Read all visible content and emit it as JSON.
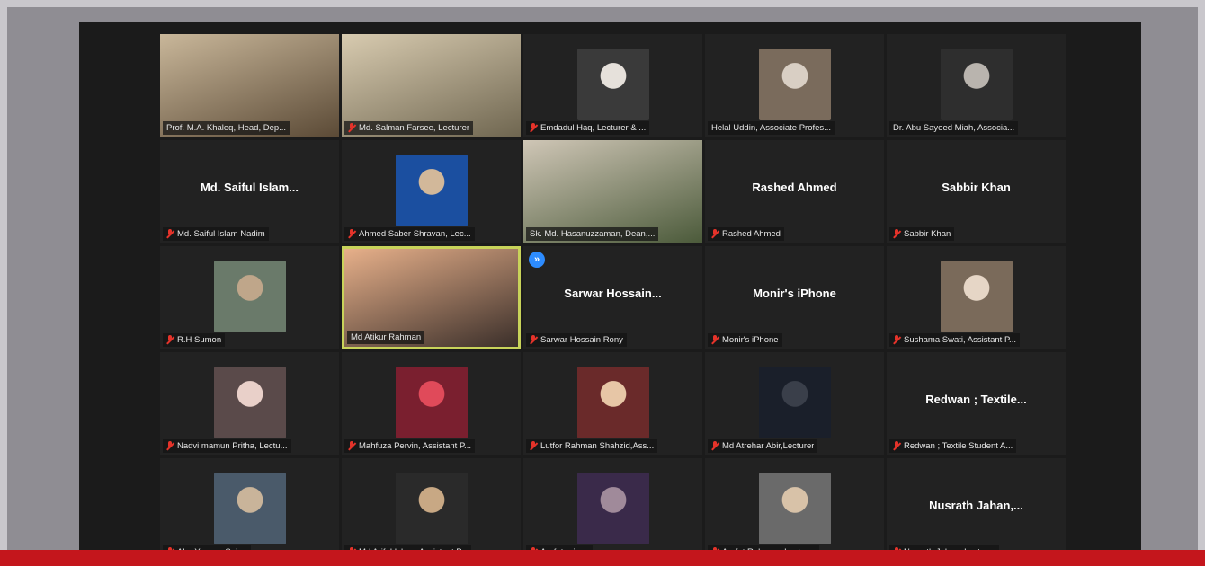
{
  "participants": [
    {
      "label": "Prof. M.A. Khaleq, Head, Dep...",
      "muted": false,
      "display": "video",
      "active": false
    },
    {
      "label": "Md. Salman Farsee, Lecturer",
      "muted": true,
      "display": "video",
      "active": false
    },
    {
      "label": "Emdadul Haq, Lecturer & ...",
      "muted": true,
      "display": "photo",
      "active": false
    },
    {
      "label": "Helal Uddin, Associate Profes...",
      "muted": false,
      "display": "photo",
      "active": false
    },
    {
      "label": "Dr. Abu Sayeed Miah, Associa...",
      "muted": false,
      "display": "photo",
      "active": false
    },
    {
      "label": "Md. Saiful Islam Nadim",
      "muted": true,
      "display": "name",
      "big_name": "Md. Saiful Islam...",
      "active": false
    },
    {
      "label": "Ahmed Saber Shravan, Lec...",
      "muted": true,
      "display": "photo",
      "active": false
    },
    {
      "label": "Sk. Md. Hasanuzzaman, Dean,...",
      "muted": false,
      "display": "video",
      "active": false
    },
    {
      "label": "Rashed Ahmed",
      "muted": true,
      "display": "name",
      "big_name": "Rashed Ahmed",
      "active": false
    },
    {
      "label": "Sabbir Khan",
      "muted": true,
      "display": "name",
      "big_name": "Sabbir Khan",
      "active": false
    },
    {
      "label": "R.H Sumon",
      "muted": true,
      "display": "photo",
      "active": false
    },
    {
      "label": "Md Atikur Rahman",
      "muted": false,
      "display": "video",
      "active": true
    },
    {
      "label": "Sarwar Hossain Rony",
      "muted": true,
      "display": "name",
      "big_name": "Sarwar Hossain...",
      "badge": "»",
      "active": false
    },
    {
      "label": "Monir's iPhone",
      "muted": true,
      "display": "name",
      "big_name": "Monir's iPhone",
      "active": false
    },
    {
      "label": "Sushama Swati, Assistant P...",
      "muted": true,
      "display": "photo",
      "active": false
    },
    {
      "label": "Nadvi mamun Pritha, Lectu...",
      "muted": true,
      "display": "photo",
      "active": false
    },
    {
      "label": "Mahfuza Pervin, Assistant P...",
      "muted": true,
      "display": "photo",
      "active": false
    },
    {
      "label": "Lutfor Rahman Shahzid,Ass...",
      "muted": true,
      "display": "photo",
      "active": false
    },
    {
      "label": "Md Atrehar Abir,Lecturer",
      "muted": true,
      "display": "photo",
      "active": false
    },
    {
      "label": "Redwan ; Textile Student A...",
      "muted": true,
      "display": "name",
      "big_name": "Redwan ; Textile...",
      "active": false
    },
    {
      "label": "Abu Younus Sujon",
      "muted": true,
      "display": "photo",
      "active": false
    },
    {
      "label": "Md Ariful Islam, Assistant P...",
      "muted": true,
      "display": "photo",
      "active": false
    },
    {
      "label": "Arafat prince",
      "muted": true,
      "display": "photo",
      "active": false
    },
    {
      "label": "Arafat Rahman, Lecturer",
      "muted": true,
      "display": "photo",
      "active": false
    },
    {
      "label": "Nusrath Jahan, Lecturer",
      "muted": true,
      "display": "name",
      "big_name": "Nusrath Jahan,...",
      "active": false
    }
  ],
  "colors": {
    "active_border": "#c8d35a",
    "muted_icon": "#e5332a",
    "tile_bg": "#222222",
    "brand_bar": "#c4161c"
  }
}
